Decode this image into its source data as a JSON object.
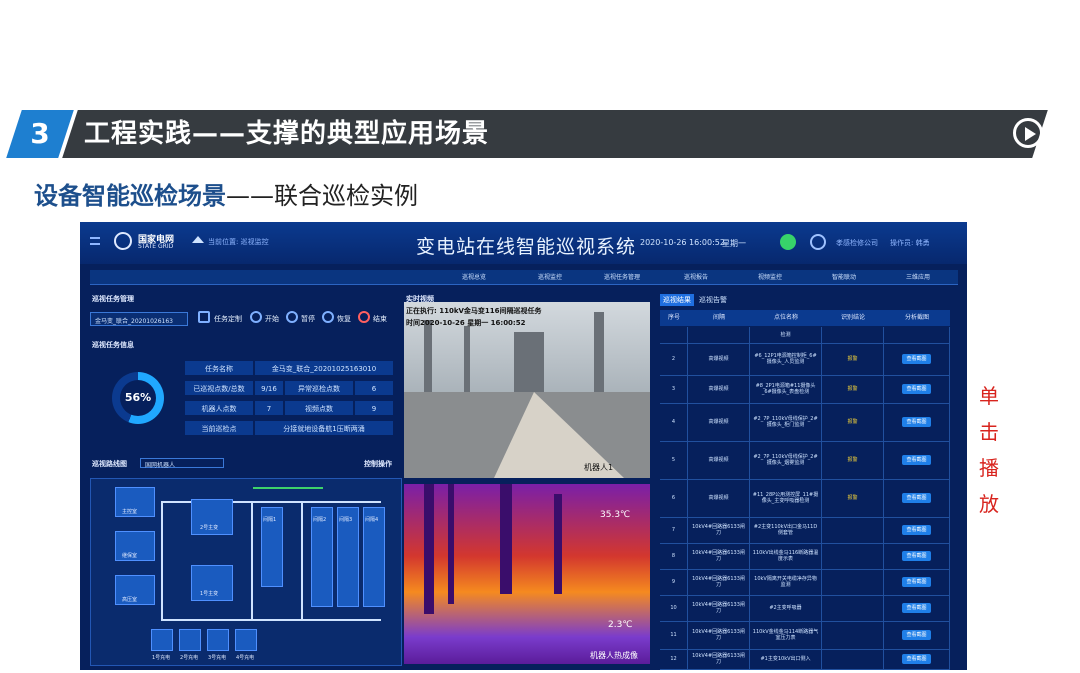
{
  "slide": {
    "section_number": "3",
    "title": "工程实践——支撑的典型应用场景",
    "subtitle_part1": "设备智能巡检场景",
    "subtitle_part2": "——联合巡检实例",
    "side_note": [
      "单",
      "击",
      "播",
      "放"
    ]
  },
  "app": {
    "logo_cn": "国家电网",
    "logo_en": "STATE GRID",
    "location": "当前位置: 巡视监控",
    "title": "变电站在线智能巡视系统",
    "datetime": "2020-10-26 16:00:52",
    "weekday": "星期一",
    "company": "孝感检修公司",
    "operator": "操作员: 韩勇"
  },
  "nav": [
    "巡视总览",
    "巡视监控",
    "巡视任务管理",
    "巡视报告",
    "视频监控",
    "智能联动",
    "三维应用"
  ],
  "task_mgmt": {
    "title": "巡视任务管理",
    "select_value": "金马变_联合_20201026163",
    "controls": [
      "任务定制",
      "开始",
      "暂停",
      "恢复",
      "结束"
    ]
  },
  "task_info": {
    "title": "巡视任务信息",
    "progress_label": "56%",
    "progress_value": 0.56,
    "task_name_label": "任务名称",
    "task_name_value": "金马变_联合_20201025163010",
    "visited_label": "已巡视点数/总数",
    "visited_value": "9/16",
    "abnormal_label": "异常巡检点数",
    "abnormal_value": "6",
    "robot_label": "机器人点数",
    "robot_value": "7",
    "video_label": "视频点数",
    "video_value": "9",
    "current_label": "当前巡检点",
    "current_value": "分接就地设备航1压断两涌"
  },
  "route": {
    "title": "巡视路线图",
    "robot_select": "国网机器人",
    "control_label": "控制操作",
    "labels": [
      "主控室",
      "1号主变",
      "2号主变",
      "继保室",
      "高压室",
      "间隔1",
      "间隔2",
      "间隔3",
      "间隔4",
      "1号充电",
      "2号充电",
      "3号充电",
      "4号充电"
    ]
  },
  "video": {
    "title": "实时视频",
    "overlay1": "正在执行: 110kV金马变116间隔巡视任务",
    "overlay2": "时间2020-10-26 星期一 16:00:52",
    "robot_label": "机器人1",
    "ir_temp_high": "35.3℃",
    "ir_temp_low": "2.3℃",
    "ir_label": "机器人热成像"
  },
  "right_panel": {
    "tabs": [
      "巡视结果",
      "巡视告警"
    ],
    "headers": [
      "序号",
      "间隔",
      "点位名称",
      "识别结论",
      "分析截图"
    ],
    "view_label": "查看截图",
    "rows": [
      {
        "no": "",
        "bay": "",
        "point": "检测",
        "result": "",
        "btn": false
      },
      {
        "no": "2",
        "bay": "高爆视频",
        "point": "#6_12P1电源箱控制柜_6#摄像头_人员监测",
        "result": "报警",
        "btn": true
      },
      {
        "no": "3",
        "bay": "高爆视频",
        "point": "#8_2P1电源箱#11摄像头_6#摄像头_表盘检测",
        "result": "报警",
        "btn": true
      },
      {
        "no": "4",
        "bay": "高爆视频",
        "point": "#2_7P_110kV母线保护_2#摄像头_柜门监测",
        "result": "报警",
        "btn": true
      },
      {
        "no": "5",
        "bay": "高爆视频",
        "point": "#2_7P_110kV母线保护_2#摄像头_烟雾监测",
        "result": "报警",
        "btn": true
      },
      {
        "no": "6",
        "bay": "高爆视频",
        "point": "#11_28P公用测控屏_11#摄像头_主变呼吸器检测",
        "result": "报警",
        "btn": true
      },
      {
        "no": "7",
        "bay": "10kV4#回路器6133闸刀",
        "point": "#2主变110kV出口金马11D侧套管",
        "result": "",
        "btn": true
      },
      {
        "no": "8",
        "bay": "10kV4#回路器6133闸刀",
        "point": "110kV出线金马116断路器温度示表",
        "result": "",
        "btn": true
      },
      {
        "no": "9",
        "bay": "10kV4#回路器6133闸刀",
        "point": "10kV隔离开关电缆净存异物监测",
        "result": "",
        "btn": true
      },
      {
        "no": "10",
        "bay": "10kV4#回路器6133闸刀",
        "point": "#2主变呼吸器",
        "result": "",
        "btn": true
      },
      {
        "no": "11",
        "bay": "10kV4#回路器6133闸刀",
        "point": "110kV金线金马114断路器气室压力表",
        "result": "",
        "btn": true
      },
      {
        "no": "12",
        "bay": "10kV4#回路器6133闸刀",
        "point": "#1主变10kV出口侧入",
        "result": "",
        "btn": true
      }
    ]
  },
  "colors": {
    "accent": "#1f7fe8",
    "screen_bg": "#06205c",
    "alarm": "#f5d43a",
    "note_red": "#d8241e",
    "section_blue": "#1e7fd0"
  }
}
